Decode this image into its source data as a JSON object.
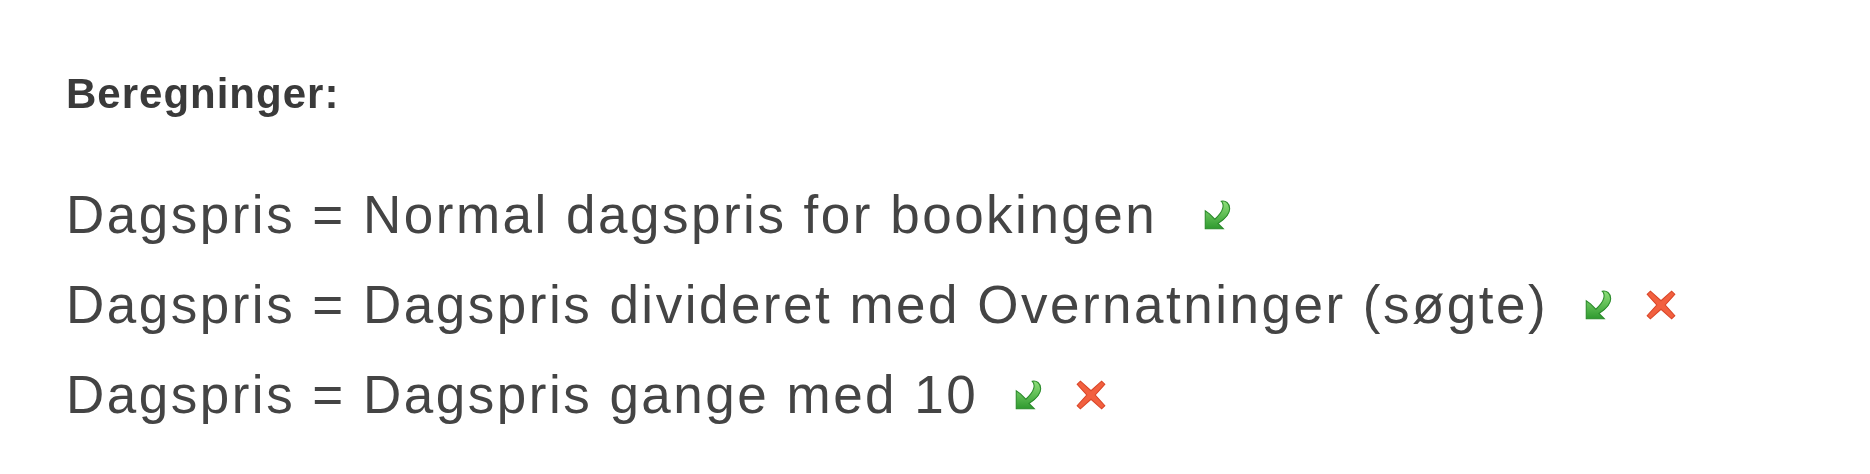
{
  "heading": "Beregninger:",
  "rows": [
    {
      "text": "Dagspris = Normal dagspris for bookingen",
      "deletable": false
    },
    {
      "text": "Dagspris = Dagspris divideret med Overnatninger (søgte)",
      "deletable": true
    },
    {
      "text": "Dagspris = Dagspris gange med 10",
      "deletable": true
    }
  ]
}
